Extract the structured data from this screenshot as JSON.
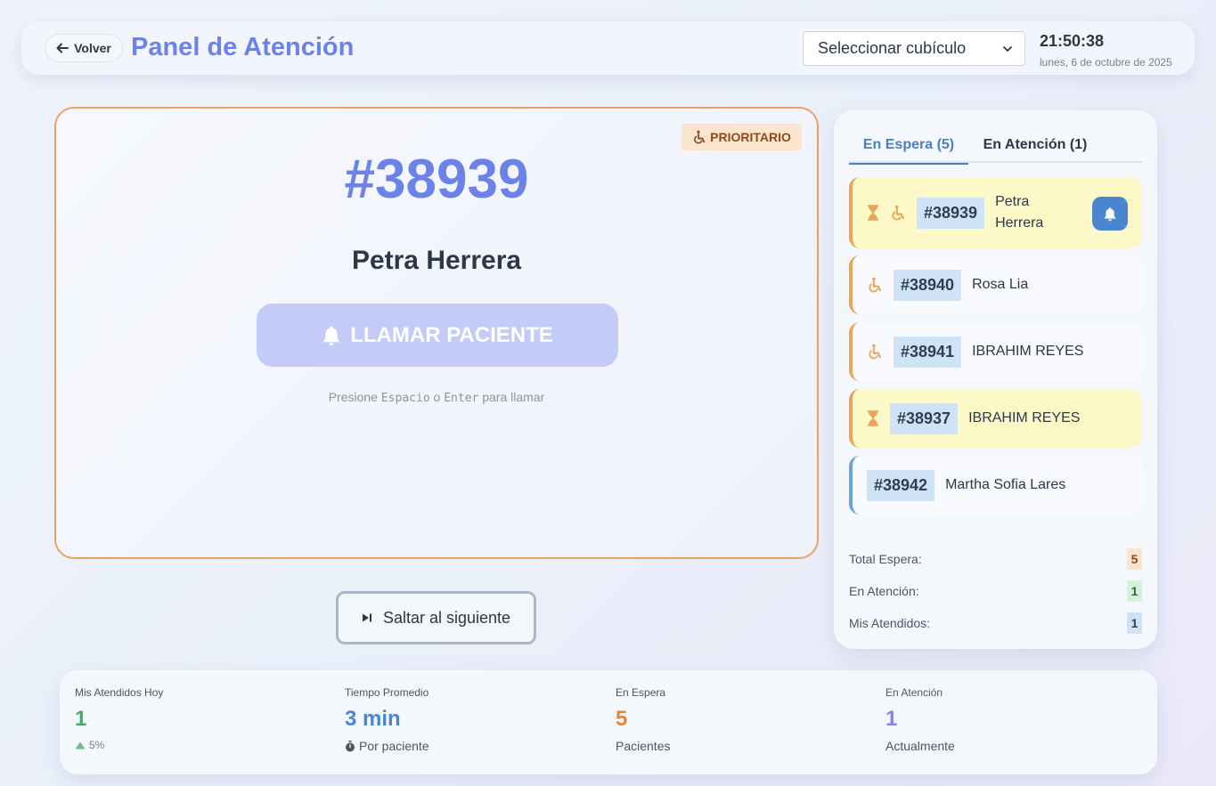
{
  "header": {
    "back_label": "Volver",
    "title": "Panel de Atención",
    "cubicle_select": "Seleccionar cubículo",
    "time": "21:50:38",
    "date": "lunes, 6 de octubre de 2025"
  },
  "current": {
    "badge": "PRIORITARIO",
    "ticket": "#38939",
    "name": "Petra Herrera",
    "call_label": "LLAMAR PACIENTE",
    "hint_prefix": "Presione",
    "hint_key1": "Espacio",
    "hint_mid": "o",
    "hint_key2": "Enter",
    "hint_suffix": "para llamar",
    "skip_label": "Saltar al siguiente"
  },
  "sidebar": {
    "tabs": [
      {
        "label": "En Espera (5)"
      },
      {
        "label": "En Atención (1)"
      }
    ],
    "queue": [
      {
        "ticket": "#38939",
        "name": "Petra Herrera"
      },
      {
        "ticket": "#38940",
        "name": "Rosa Lia"
      },
      {
        "ticket": "#38941",
        "name": "IBRAHIM REYES"
      },
      {
        "ticket": "#38937",
        "name": "IBRAHIM REYES"
      },
      {
        "ticket": "#38942",
        "name": "Martha Sofia Lares"
      }
    ],
    "summary": [
      {
        "label": "Total Espera:",
        "value": "5"
      },
      {
        "label": "En Atención:",
        "value": "1"
      },
      {
        "label": "Mis Atendidos:",
        "value": "1"
      }
    ]
  },
  "stats": [
    {
      "label": "Mis Atendidos Hoy",
      "value": "1",
      "sub": "5%"
    },
    {
      "label": "Tiempo Promedio",
      "value": "3 min",
      "sub": "Por paciente"
    },
    {
      "label": "En Espera",
      "value": "5",
      "sub": "Pacientes"
    },
    {
      "label": "En Atención",
      "value": "1",
      "sub": "Actualmente"
    }
  ],
  "colors": {
    "accent": "#6b83e8",
    "priority_border": "#e9a264",
    "waiting_bg": "#fdf8c8",
    "ticket_bg": "#cfe3f7",
    "stat_green": "#48a868",
    "stat_blue": "#4a86cf",
    "stat_orange": "#dd8a3c",
    "stat_purple": "#8a84e0"
  }
}
